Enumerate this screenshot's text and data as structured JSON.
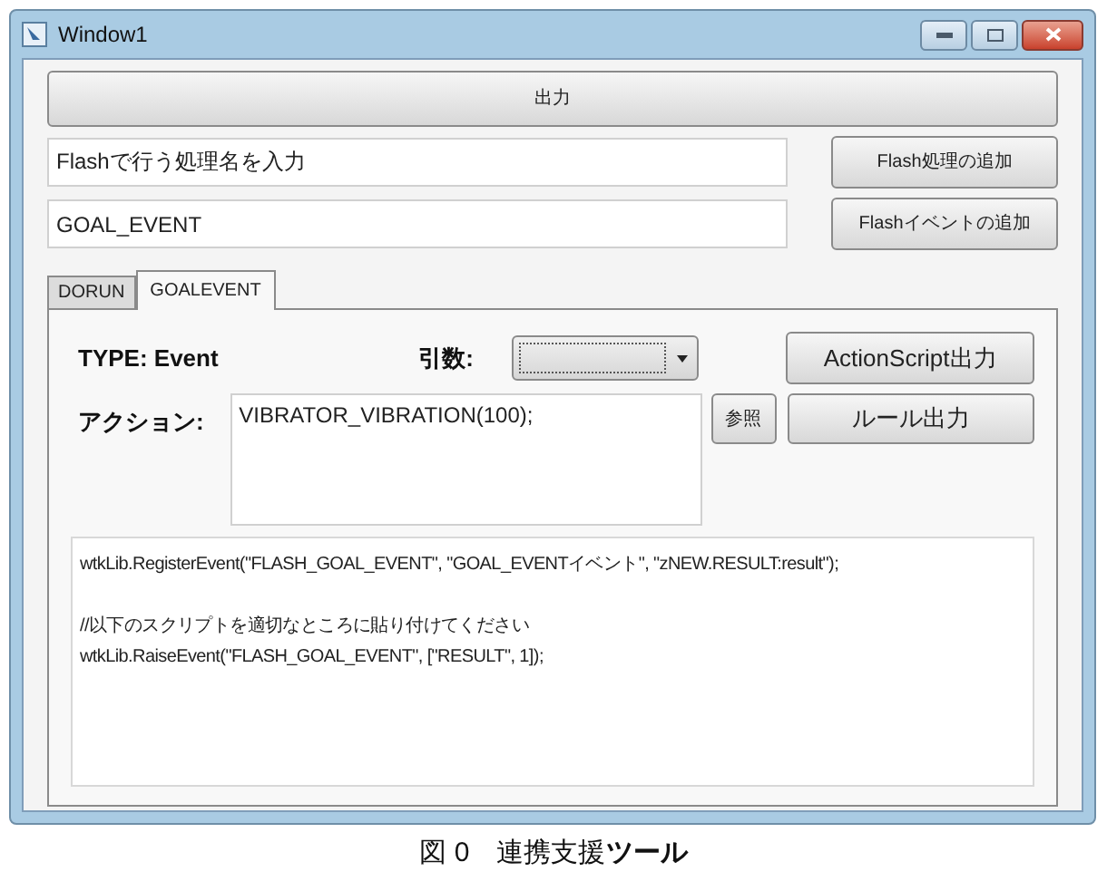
{
  "window": {
    "title": "Window1"
  },
  "output_button": "出力",
  "fields": [
    {
      "value": "Flashで行う処理名を入力",
      "button": "Flash処理の追加"
    },
    {
      "value": "GOAL_EVENT",
      "button": "Flashイベントの追加"
    }
  ],
  "tabs": [
    {
      "label": "DORUN",
      "selected": false
    },
    {
      "label": "GOALEVENT",
      "selected": true
    }
  ],
  "panel": {
    "type_label": "TYPE: Event",
    "args_label": "引数:",
    "action_label": "アクション:",
    "action_value": "VIBRATOR_VIBRATION(100);",
    "browse_button": "参照",
    "actionscript_button": "ActionScript出力",
    "rule_button": "ルール出力",
    "code_blocks": [
      [
        "wtkLib.RegisterEvent(\"FLASH_GOAL_EVENT\", \"GOAL_EVENTイベント\", \"zNEW.RESULT:result\");"
      ],
      [
        "//以下のスクリプトを適切なところに貼り付けてください",
        "wtkLib.RaiseEvent(\"FLASH_GOAL_EVENT\", [\"RESULT\", 1]);"
      ]
    ]
  },
  "caption": "図 0　連携支援**ツール**"
}
